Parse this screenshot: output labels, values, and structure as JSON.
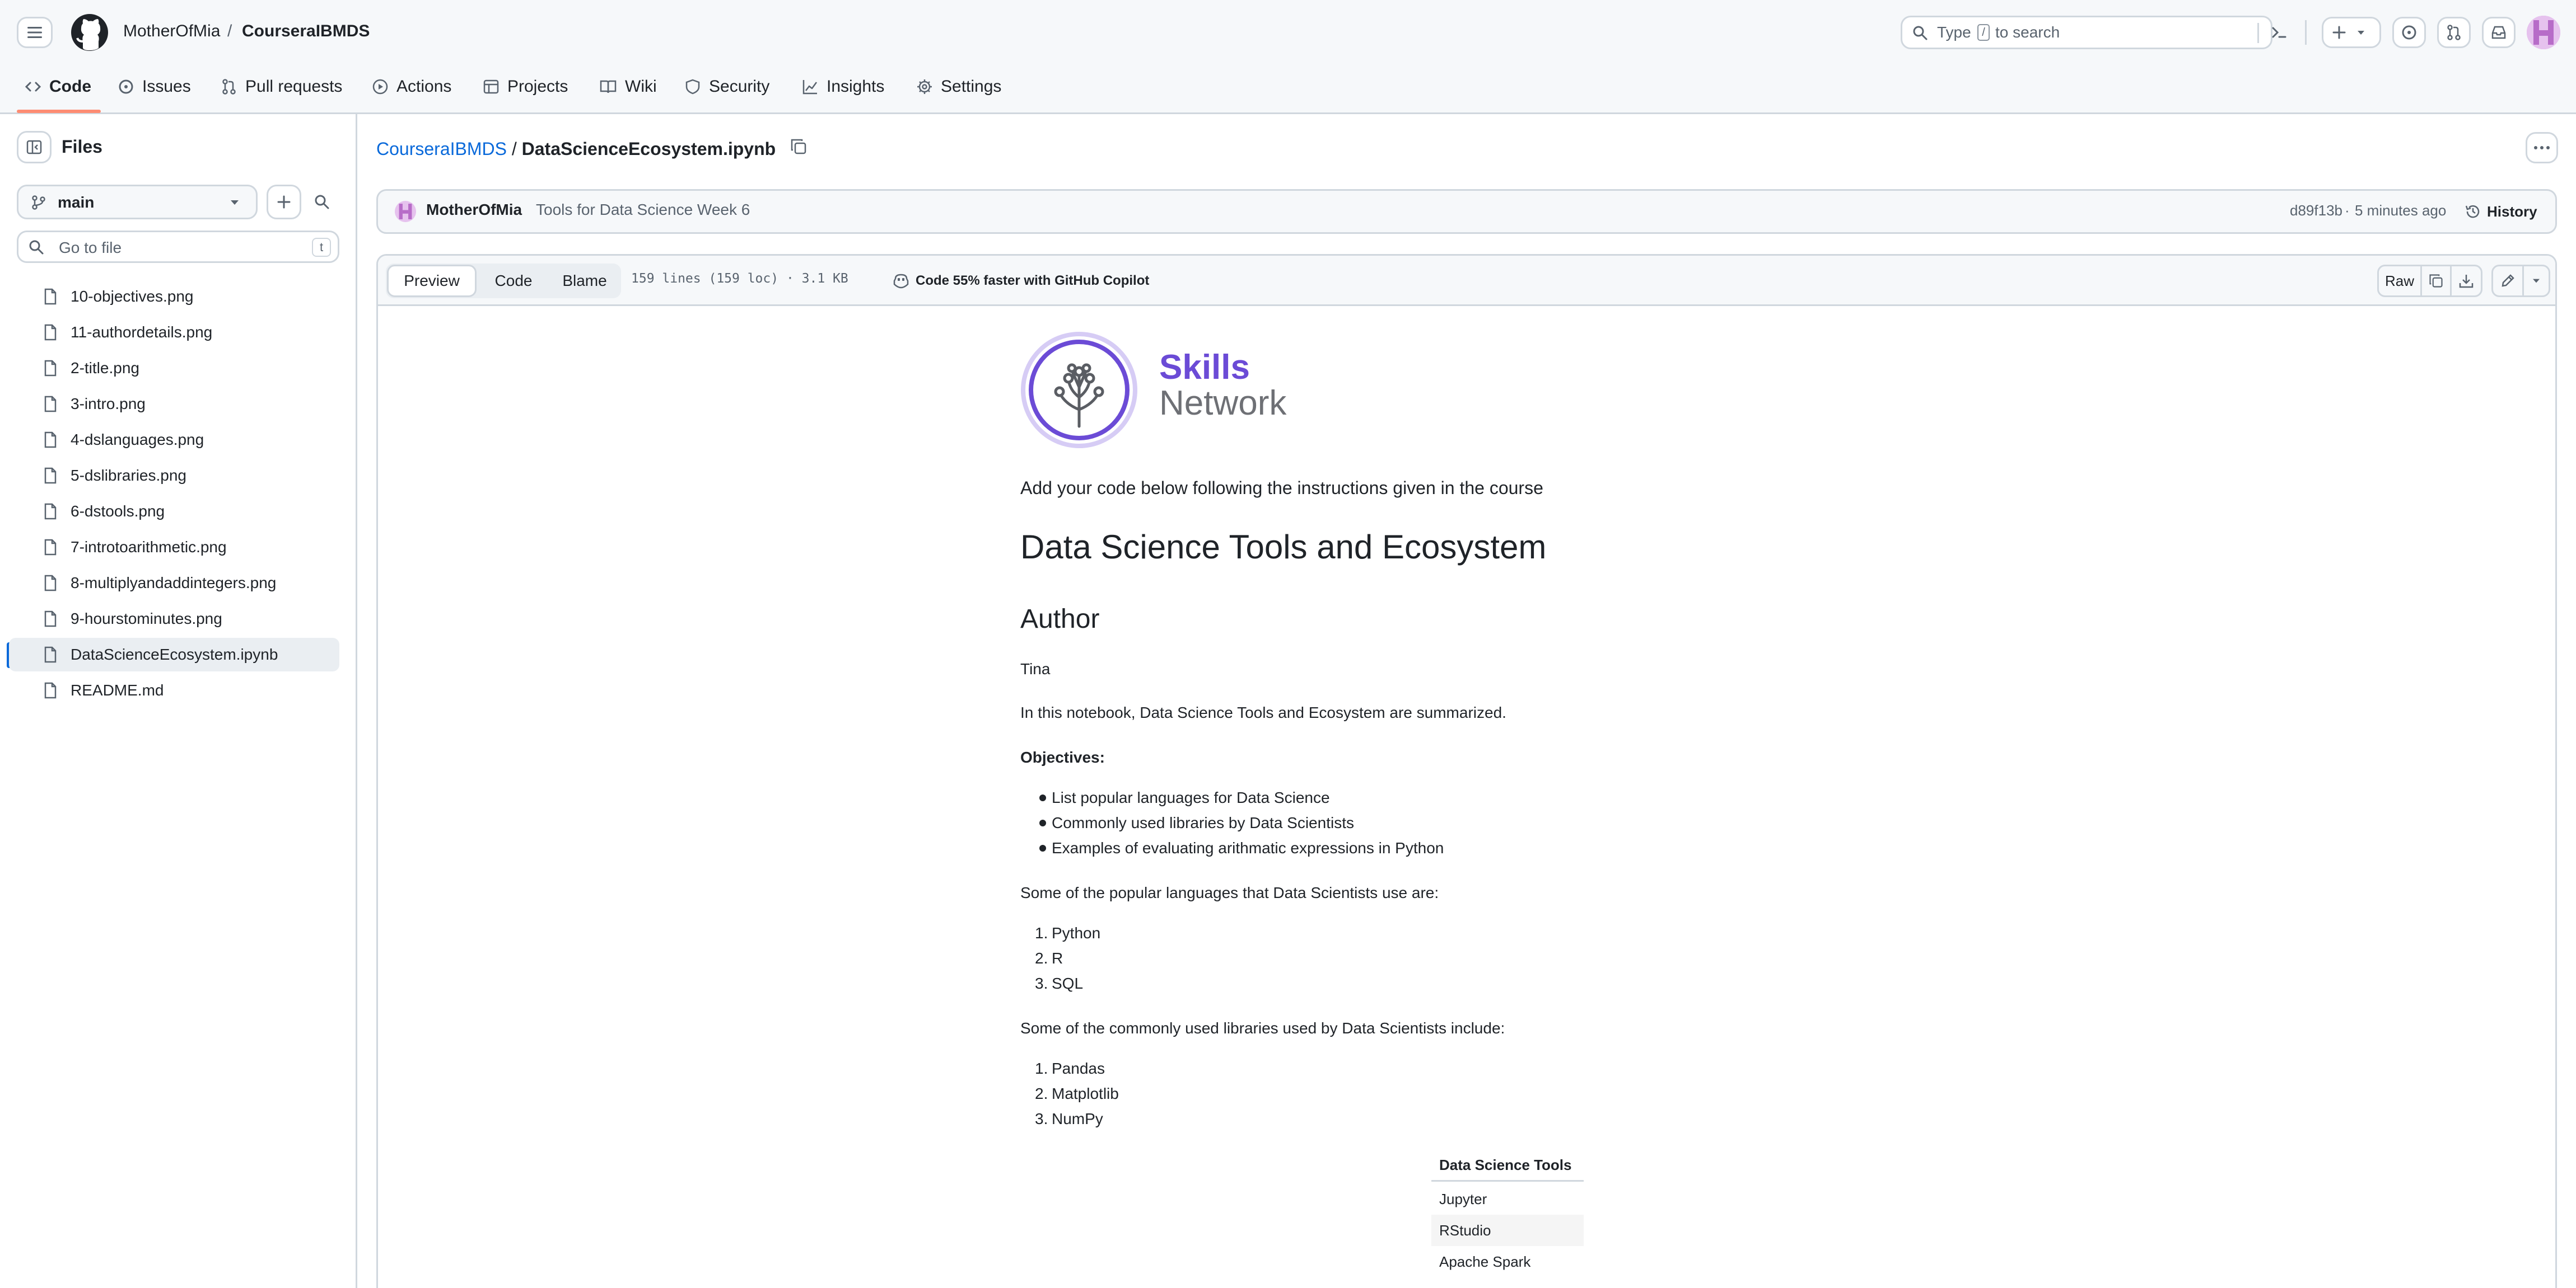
{
  "header": {
    "owner": "MotherOfMia",
    "separator": "/",
    "repo": "CourseraIBMDS",
    "search_placeholder": "Type / to search",
    "search_key": "/",
    "search_prefix": "Type",
    "search_suffix": "to search"
  },
  "nav": {
    "tabs": [
      {
        "label": "Code",
        "icon": "code-icon",
        "active": true
      },
      {
        "label": "Issues",
        "icon": "issue-icon"
      },
      {
        "label": "Pull requests",
        "icon": "pull-request-icon"
      },
      {
        "label": "Actions",
        "icon": "play-icon"
      },
      {
        "label": "Projects",
        "icon": "table-icon"
      },
      {
        "label": "Wiki",
        "icon": "book-icon"
      },
      {
        "label": "Security",
        "icon": "shield-icon"
      },
      {
        "label": "Insights",
        "icon": "graph-icon"
      },
      {
        "label": "Settings",
        "icon": "gear-icon"
      }
    ]
  },
  "sidebar": {
    "title": "Files",
    "branch": "main",
    "filter_placeholder": "Go to file",
    "filter_shortcut": "t",
    "files": [
      {
        "name": "10-objectives.png"
      },
      {
        "name": "11-authordetails.png"
      },
      {
        "name": "2-title.png"
      },
      {
        "name": "3-intro.png"
      },
      {
        "name": "4-dslanguages.png"
      },
      {
        "name": "5-dslibraries.png"
      },
      {
        "name": "6-dstools.png"
      },
      {
        "name": "7-introtoarithmetic.png"
      },
      {
        "name": "8-multiplyandaddintegers.png"
      },
      {
        "name": "9-hourstominutes.png"
      },
      {
        "name": "DataScienceEcosystem.ipynb",
        "active": true
      },
      {
        "name": "README.md"
      }
    ]
  },
  "file": {
    "repo_link": "CourseraIBMDS",
    "separator": "/",
    "name": "DataScienceEcosystem.ipynb"
  },
  "commit": {
    "author": "MotherOfMia",
    "message": "Tools for Data Science Week 6",
    "sha": "d89f13b",
    "dot": "·",
    "time": "5 minutes ago",
    "history_label": "History"
  },
  "viewer": {
    "tabs": [
      "Preview",
      "Code",
      "Blame"
    ],
    "info": "159 lines (159 loc) · 3.1 KB",
    "copilot": "Code 55% faster with GitHub Copilot",
    "raw": "Raw"
  },
  "notebook": {
    "logo_line1": "Skills",
    "logo_line2": "Network",
    "intro": "Add your code below following the instructions given in the course",
    "title": "Data Science Tools and Ecosystem",
    "author_heading": "Author",
    "author_name": "Tina",
    "summary": "In this notebook, Data Science Tools and Ecosystem are summarized.",
    "objectives_heading": "Objectives:",
    "objectives": [
      "List popular languages for Data Science",
      "Commonly used libraries by Data Scientists",
      "Examples of evaluating arithmatic expressions in Python"
    ],
    "languages_intro": "Some of the popular languages that Data Scientists use are:",
    "languages": [
      "Python",
      "R",
      "SQL"
    ],
    "libraries_intro": "Some of the commonly used libraries used by Data Scientists include:",
    "libraries": [
      "Pandas",
      "Matplotlib",
      "NumPy"
    ],
    "tools_table": {
      "header": "Data Science Tools",
      "rows": [
        "Jupyter",
        "RStudio",
        "Apache Spark"
      ]
    },
    "list_markers": [
      "1.",
      "2.",
      "3."
    ]
  },
  "colors": {
    "accent": "#0969da",
    "tab_underline": "#fd8c73",
    "logo_purple": "#6b4bd6",
    "logo_gray": "#6e7075"
  }
}
